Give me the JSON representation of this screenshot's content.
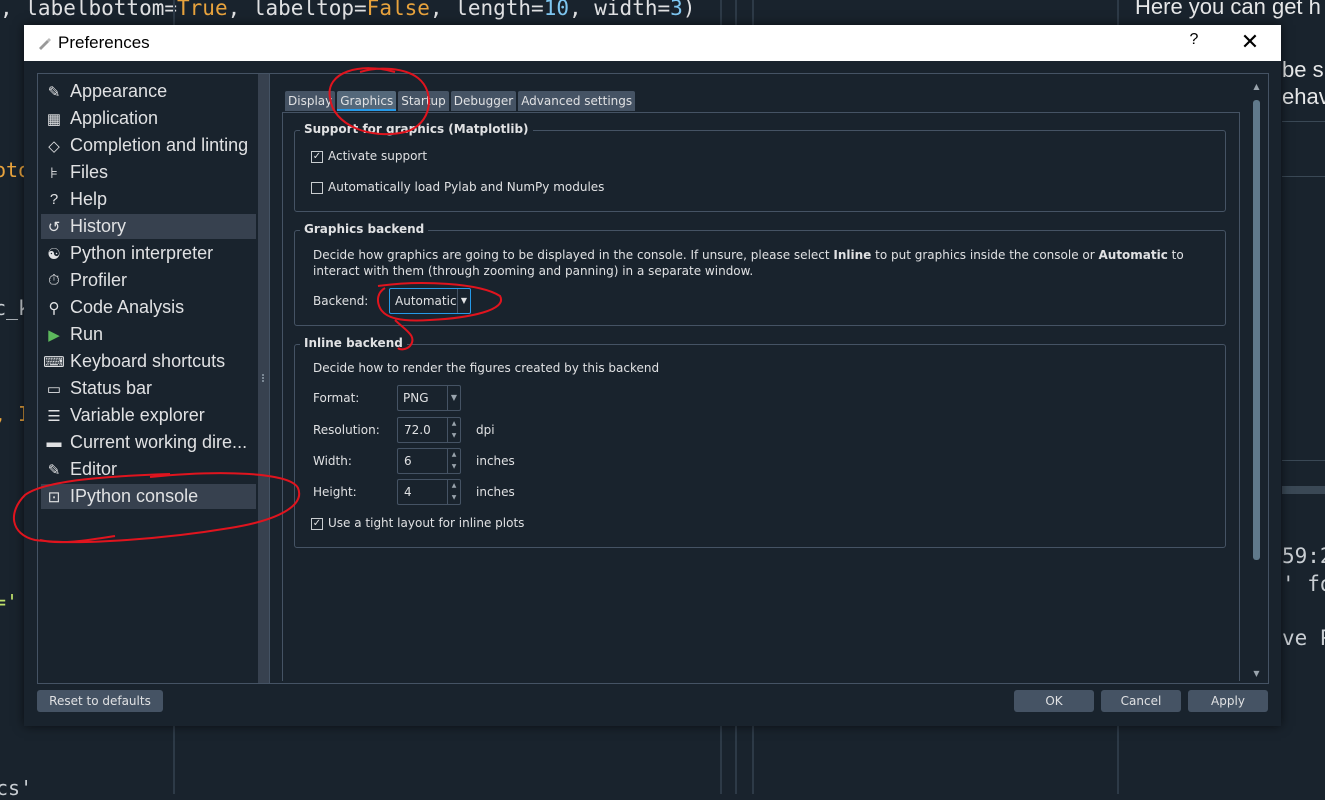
{
  "background": {
    "code_line": {
      "prefix": ", labelbottom=",
      "v1": "True",
      "mid1": ", labeltop=",
      "v2": "False",
      "mid2": ", length=",
      "v3": "10",
      "mid3": ", width=",
      "v4": "3",
      "suffix": ")"
    },
    "fragments": [
      "oto",
      "c_k",
      ", I",
      "='",
      "cs'"
    ],
    "right_text": [
      "Here you can get h",
      "be s",
      "ehav",
      "59:2",
      "' fo",
      "ve P"
    ]
  },
  "dialog": {
    "title": "Preferences",
    "help": "?",
    "close": "✕"
  },
  "sidebar": {
    "items": [
      {
        "label": "Appearance",
        "icon": "✎"
      },
      {
        "label": "Application",
        "icon": "▦"
      },
      {
        "label": "Completion and linting",
        "icon": "◇"
      },
      {
        "label": "Files",
        "icon": "⊧"
      },
      {
        "label": "Help",
        "icon": "?"
      },
      {
        "label": "History",
        "icon": "↺"
      },
      {
        "label": "Python interpreter",
        "icon": "☯"
      },
      {
        "label": "Profiler",
        "icon": "⏱"
      },
      {
        "label": "Code Analysis",
        "icon": "⚲"
      },
      {
        "label": "Run",
        "icon": "▶"
      },
      {
        "label": "Keyboard shortcuts",
        "icon": "⌨"
      },
      {
        "label": "Status bar",
        "icon": "▭"
      },
      {
        "label": "Variable explorer",
        "icon": "☰"
      },
      {
        "label": "Current working dire...",
        "icon": "▬"
      },
      {
        "label": "Editor",
        "icon": "✎"
      },
      {
        "label": "IPython console",
        "icon": "⊡"
      }
    ]
  },
  "tabs": [
    "Display",
    "Graphics",
    "Startup",
    "Debugger",
    "Advanced settings"
  ],
  "graphics_support": {
    "title": "Support for graphics (Matplotlib)",
    "activate_label": "Activate support",
    "activate_checked": "✓",
    "autoload_label": "Automatically load Pylab and NumPy modules",
    "autoload_checked": ""
  },
  "graphics_backend": {
    "title": "Graphics backend",
    "desc_a": "Decide how graphics are going to be displayed in the console. If unsure, please select ",
    "desc_inline": "Inline",
    "desc_b": " to put graphics inside the console or ",
    "desc_auto": "Automatic",
    "desc_c": " to interact with them (through zooming and panning) in a separate window.",
    "backend_label": "Backend:",
    "backend_value": "Automatic"
  },
  "inline_backend": {
    "title": "Inline backend",
    "desc": "Decide how to render the figures created by this backend",
    "format_label": "Format:",
    "format_value": "PNG",
    "resolution_label": "Resolution:",
    "resolution_value": "72.0",
    "resolution_unit": "dpi",
    "width_label": "Width:",
    "width_value": "6",
    "width_unit": "inches",
    "height_label": "Height:",
    "height_value": "4",
    "height_unit": "inches",
    "tight_label": "Use a tight layout for inline plots",
    "tight_checked": "✓"
  },
  "buttons": {
    "reset": "Reset to defaults",
    "ok": "OK",
    "cancel": "Cancel",
    "apply": "Apply"
  },
  "colors": {
    "annotation": "#e0141e",
    "selection": "#37414f",
    "accent": "#259ae9"
  }
}
